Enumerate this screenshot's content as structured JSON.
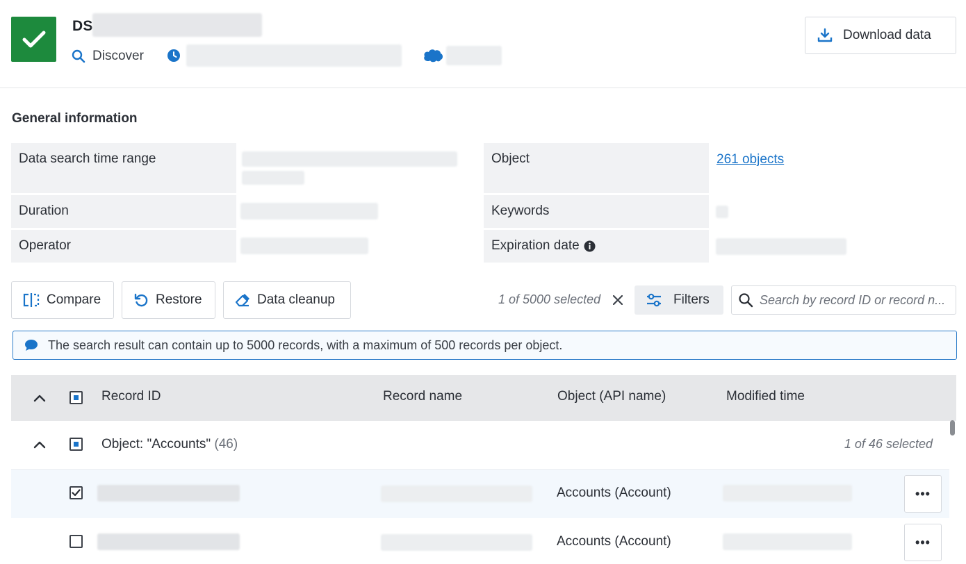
{
  "header": {
    "title": "DS",
    "app_label": "Discover",
    "download_label": "Download data"
  },
  "general_info": {
    "title": "General information",
    "labels": {
      "time_range": "Data search time range",
      "duration": "Duration",
      "operator": "Operator",
      "object": "Object",
      "keywords": "Keywords",
      "expiration": "Expiration date"
    },
    "object_link": "261 objects"
  },
  "toolbar": {
    "compare": "Compare",
    "restore": "Restore",
    "cleanup": "Data cleanup",
    "selected_text": "1 of 5000 selected",
    "filters": "Filters",
    "search_placeholder": "Search by record ID or record n..."
  },
  "notice": {
    "text": "The search result can contain up to 5000 records, with a maximum of 500 records per object."
  },
  "table": {
    "columns": [
      "Record ID",
      "Record name",
      "Object (API name)",
      "Modified time"
    ],
    "group": {
      "title": "Object: \"Accounts\"",
      "count": "(46)",
      "selected": "1 of 46 selected"
    },
    "rows": [
      {
        "object": "Accounts (Account)",
        "checked": true
      },
      {
        "object": "Accounts (Account)",
        "checked": false
      }
    ],
    "more": "•••"
  },
  "colors": {
    "success": "#1d8a3d",
    "accent": "#1a74c9",
    "label_bg": "#f1f2f4",
    "header_bg": "#e6e7e9"
  }
}
